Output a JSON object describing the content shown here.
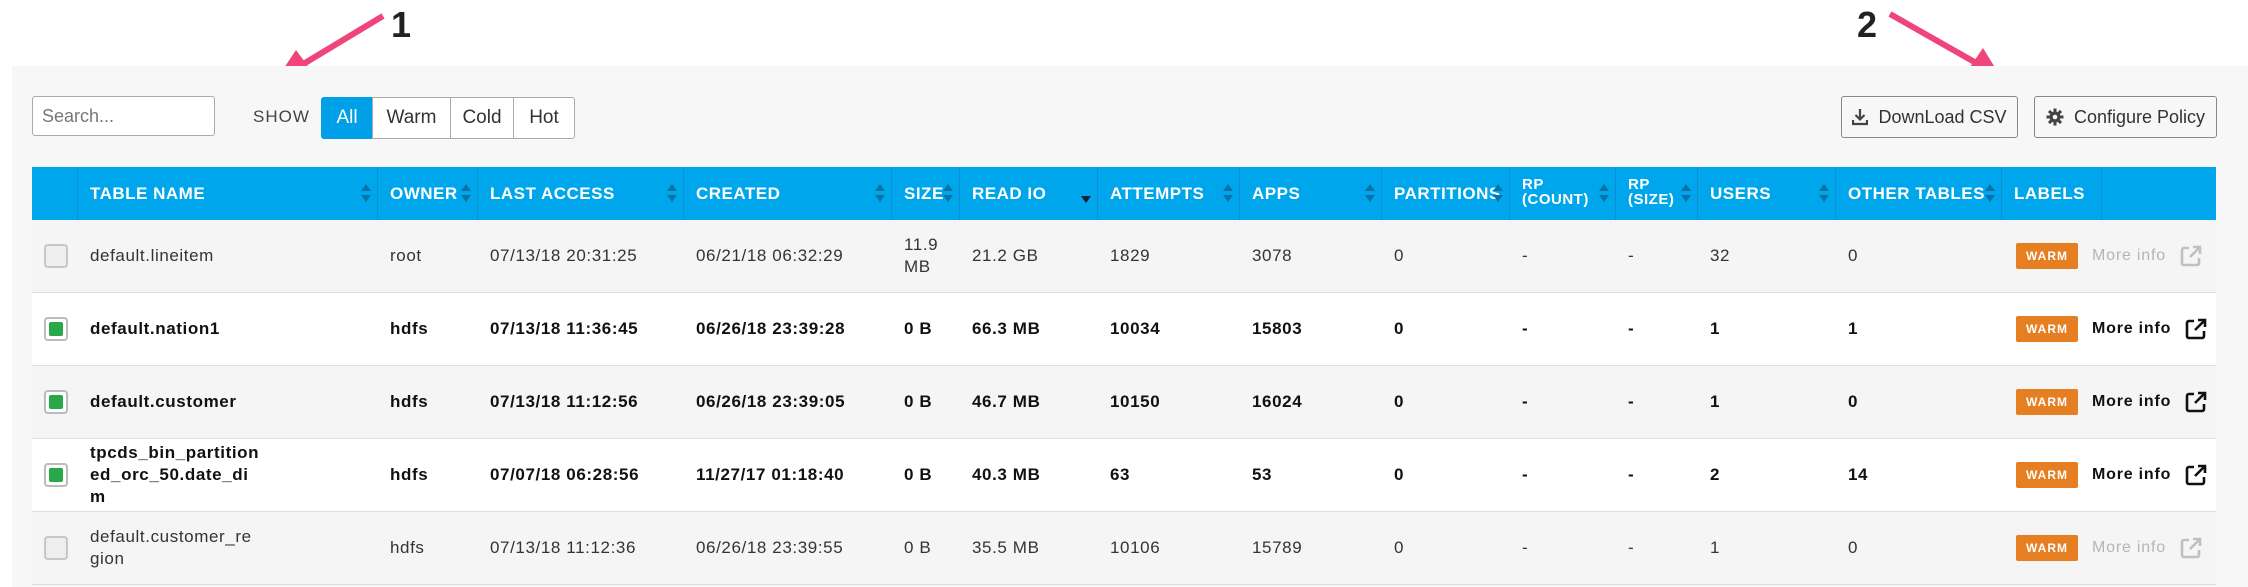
{
  "annotations": [
    {
      "label": "1"
    },
    {
      "label": "2"
    }
  ],
  "toolbar": {
    "search_placeholder": "Search...",
    "show_label": "SHOW",
    "filters": [
      "All",
      "Warm",
      "Cold",
      "Hot"
    ],
    "active_filter": "All",
    "download_label": "DownLoad CSV",
    "configure_label": "Configure Policy"
  },
  "table": {
    "columns": [
      "TABLE NAME",
      "OWNER",
      "LAST ACCESS",
      "CREATED",
      "SIZE",
      "READ IO",
      "ATTEMPTS",
      "APPS",
      "PARTITIONS",
      "RP (COUNT)",
      "RP (SIZE)",
      "USERS",
      "OTHER TABLES",
      "LABELS"
    ],
    "rows": [
      {
        "checked": false,
        "name": "default.lineitem",
        "owner": "root",
        "last_access": "07/13/18 20:31:25",
        "created": "06/21/18 06:32:29",
        "size": "11.9 MB",
        "read_io": "21.2 GB",
        "attempts": "1829",
        "apps": "3078",
        "partitions": "0",
        "rp_count": "-",
        "rp_size": "-",
        "users": "32",
        "other_tables": "0",
        "label": "WARM",
        "more_info": "More info",
        "more_enabled": false
      },
      {
        "checked": true,
        "name": "default.nation1",
        "owner": "hdfs",
        "last_access": "07/13/18 11:36:45",
        "created": "06/26/18 23:39:28",
        "size": "0 B",
        "read_io": "66.3 MB",
        "attempts": "10034",
        "apps": "15803",
        "partitions": "0",
        "rp_count": "-",
        "rp_size": "-",
        "users": "1",
        "other_tables": "1",
        "label": "WARM",
        "more_info": "More info",
        "more_enabled": true
      },
      {
        "checked": true,
        "name": "default.customer",
        "owner": "hdfs",
        "last_access": "07/13/18 11:12:56",
        "created": "06/26/18 23:39:05",
        "size": "0 B",
        "read_io": "46.7 MB",
        "attempts": "10150",
        "apps": "16024",
        "partitions": "0",
        "rp_count": "-",
        "rp_size": "-",
        "users": "1",
        "other_tables": "0",
        "label": "WARM",
        "more_info": "More info",
        "more_enabled": true
      },
      {
        "checked": true,
        "name": "tpcds_bin_partitioned_orc_50.date_dim",
        "owner": "hdfs",
        "last_access": "07/07/18 06:28:56",
        "created": "11/27/17 01:18:40",
        "size": "0 B",
        "read_io": "40.3 MB",
        "attempts": "63",
        "apps": "53",
        "partitions": "0",
        "rp_count": "-",
        "rp_size": "-",
        "users": "2",
        "other_tables": "14",
        "label": "WARM",
        "more_info": "More info",
        "more_enabled": true
      },
      {
        "checked": false,
        "name": "default.customer_region",
        "owner": "hdfs",
        "last_access": "07/13/18 11:12:36",
        "created": "06/26/18 23:39:55",
        "size": "0 B",
        "read_io": "35.5 MB",
        "attempts": "10106",
        "apps": "15789",
        "partitions": "0",
        "rp_count": "-",
        "rp_size": "-",
        "users": "1",
        "other_tables": "0",
        "label": "WARM",
        "more_info": "More info",
        "more_enabled": false
      }
    ]
  },
  "colors": {
    "header_bg": "#00a6ec",
    "active_filter_bg": "#00a0e8",
    "warm_badge": "#e67e22",
    "checkbox_checked": "#29a84a",
    "annotation_arrow": "#f0457a"
  },
  "icons": {
    "download": "download-icon",
    "configure": "gear-icon",
    "external": "external-link-icon"
  }
}
